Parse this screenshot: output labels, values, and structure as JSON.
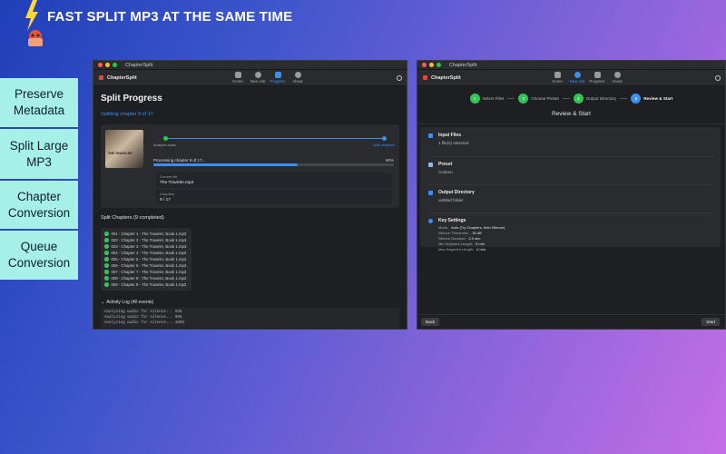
{
  "headline": "FAST SPLIT MP3 AT THE SAME TIME",
  "features": [
    "Preserve Metadata",
    "Split Large MP3",
    "Chapter Conversion",
    "Queue Conversion"
  ],
  "window1": {
    "title": "ChapterSplit",
    "app_name": "ChapterSplit",
    "nav": [
      "Home",
      "New Job",
      "Progress",
      "About"
    ],
    "active_nav": "Progress",
    "page_title": "Split Progress",
    "subtitle": "Splitting chapter 9 of 17",
    "album_text": "THE TRAVELER",
    "steps": [
      "Analyze audio",
      "Split chapters"
    ],
    "processing": "Processing chapter 9 of 17...",
    "percent": "60%",
    "progress": 0.6,
    "current_file_label": "Current file",
    "current_file": "The Traveler.mp3",
    "chapters_label": "Chapters",
    "chapters_value": "9 / 17",
    "split_chapters_title": "Split Chapters (9 completed)",
    "chapters": [
      "001 - Chapter 1 - The Traveler, Book 1.mp3",
      "002 - Chapter 2 - The Traveler, Book 1.mp3",
      "003 - Chapter 3 - The Traveler, Book 1.mp3",
      "004 - Chapter 4 - The Traveler, Book 1.mp3",
      "005 - Chapter 5 - The Traveler, Book 1.mp3",
      "006 - Chapter 6 - The Traveler, Book 1.mp3",
      "007 - Chapter 7 - The Traveler, Book 1.mp3",
      "008 - Chapter 8 - The Traveler, Book 1.mp3",
      "009 - Chapter 9 - The Traveler, Book 1.mp3"
    ],
    "activity_log_title": "Activity Log (40 events)",
    "log_lines": [
      "Analyzing audio for silence... 93%",
      "Analyzing audio for silence... 96%",
      "Analyzing audio for silence... 100%"
    ]
  },
  "window2": {
    "title": "ChapterSplit",
    "app_name": "ChapterSplit",
    "nav": [
      "Home",
      "New Job",
      "Progress",
      "About"
    ],
    "active_nav": "New Job",
    "steps": [
      {
        "n": "1",
        "label": "Select Files"
      },
      {
        "n": "2",
        "label": "Choose Preset"
      },
      {
        "n": "3",
        "label": "Output Directory"
      },
      {
        "n": "4",
        "label": "Review & Start"
      }
    ],
    "review_title": "Review & Start",
    "input_files_title": "Input Files",
    "input_files_value": "1 file(s) selected",
    "preset_title": "Preset",
    "preset_value": "Custom",
    "output_title": "Output Directory",
    "output_value": "untitled folder",
    "key_settings_title": "Key Settings",
    "key_settings": [
      {
        "k": "Mode:",
        "v": "Auto (Try Chapters, then Silence)"
      },
      {
        "k": "Silence Threshold:",
        "v": "-30 dB"
      },
      {
        "k": "Silence Duration:",
        "v": "2.0 sec"
      },
      {
        "k": "Min Segment Length:",
        "v": "5 min"
      },
      {
        "k": "Max Segment Length:",
        "v": "0 min"
      }
    ],
    "back_label": "Back",
    "start_label": "Start"
  },
  "colors": {
    "accent": "#3d8ef0",
    "success": "#33c35a",
    "feature_bg": "#a6f0e8"
  }
}
